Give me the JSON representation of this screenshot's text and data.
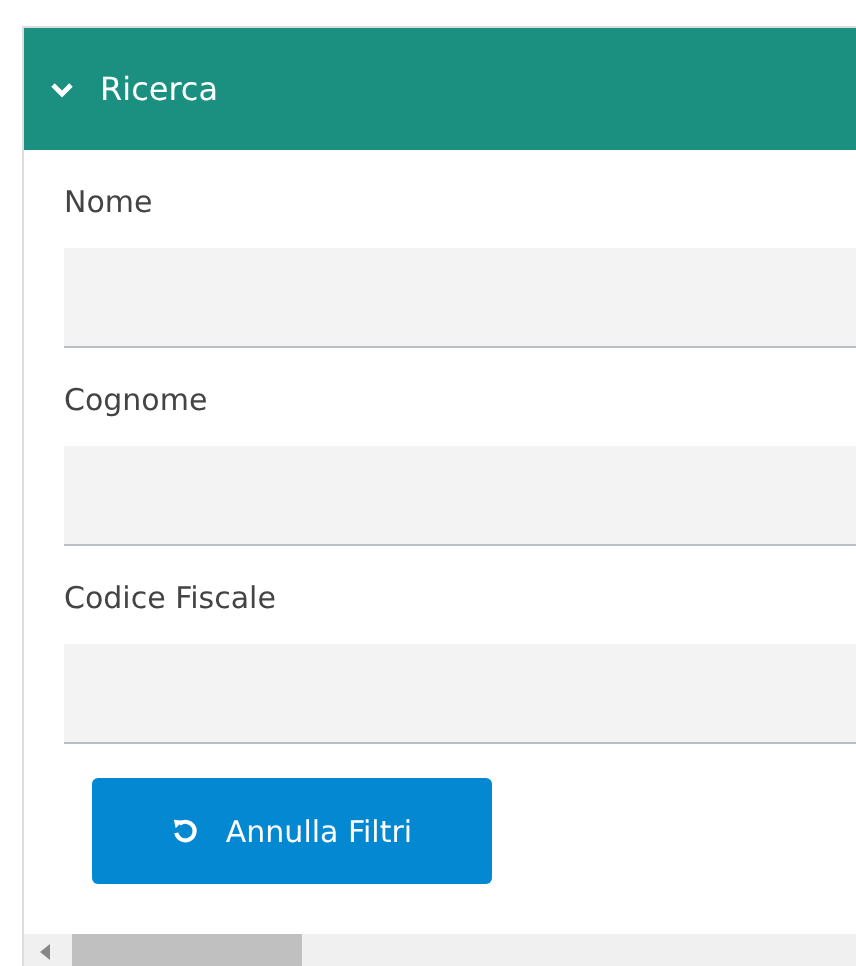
{
  "panel": {
    "title": "Ricerca",
    "expanded": true
  },
  "fields": [
    {
      "label": "Nome"
    },
    {
      "label": "Cognome"
    },
    {
      "label": "Codice Fiscale"
    }
  ],
  "button": {
    "label": "Annulla Filtri"
  }
}
